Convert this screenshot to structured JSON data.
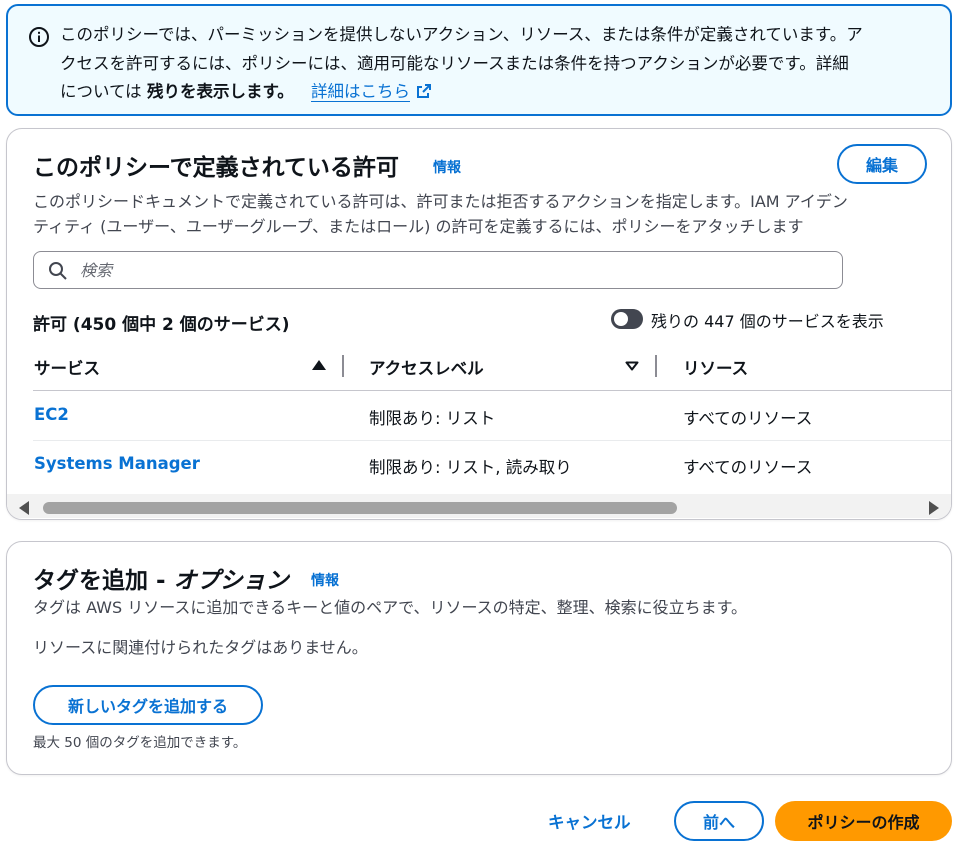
{
  "alert": {
    "line1": "このポリシーでは、パーミッションを提供しないアクション、リソース、または条件が定義されています。ア",
    "line2": "クセスを許可するには、ポリシーには、適用可能なリソースまたは条件を持つアクションが必要です。詳細",
    "line3_prefix": "については",
    "line3_bold": "残りを表示します。",
    "link": "詳細はこちら",
    "icon": "info-icon",
    "link_icon": "external-link-icon"
  },
  "permissions_card": {
    "title": "このポリシーで定義されている許可",
    "info": "情報",
    "edit_button": "編集",
    "description_line1": "このポリシードキュメントで定義されている許可は、許可または拒否するアクションを指定します。IAM アイデン",
    "description_line2": "ティティ (ユーザー、ユーザーグループ、またはロール) の許可を定義するには、ポリシーをアタッチします",
    "search_placeholder": "検索",
    "search_value": "",
    "count_label": "許可 (450 個中 2 個のサービス)",
    "toggle_label": "残りの 447 個のサービスを表示",
    "toggle_on": false,
    "columns": [
      "サービス",
      "アクセスレベル",
      "リソース"
    ],
    "rows": [
      {
        "service": "EC2",
        "access": "制限あり: リスト",
        "resource": "すべてのリソース"
      },
      {
        "service": "Systems Manager",
        "access": "制限あり: リスト, 読み取り",
        "resource": "すべてのリソース"
      }
    ]
  },
  "tags_card": {
    "title": "タグを追加 - ",
    "title_italic": "オプション",
    "info": "情報",
    "description": "タグは AWS リソースに追加できるキーと値のペアで、リソースの特定、整理、検索に役立ちます。",
    "empty_text": "リソースに関連付けられたタグはありません。",
    "add_button": "新しいタグを追加する",
    "limit_text": "最大 50 個のタグを追加できます。"
  },
  "footer": {
    "cancel": "キャンセル",
    "previous": "前へ",
    "create": "ポリシーの作成"
  },
  "colors": {
    "accent": "#0972d3",
    "primary_button": "#ff9900",
    "alert_bg": "#f0fbff"
  }
}
